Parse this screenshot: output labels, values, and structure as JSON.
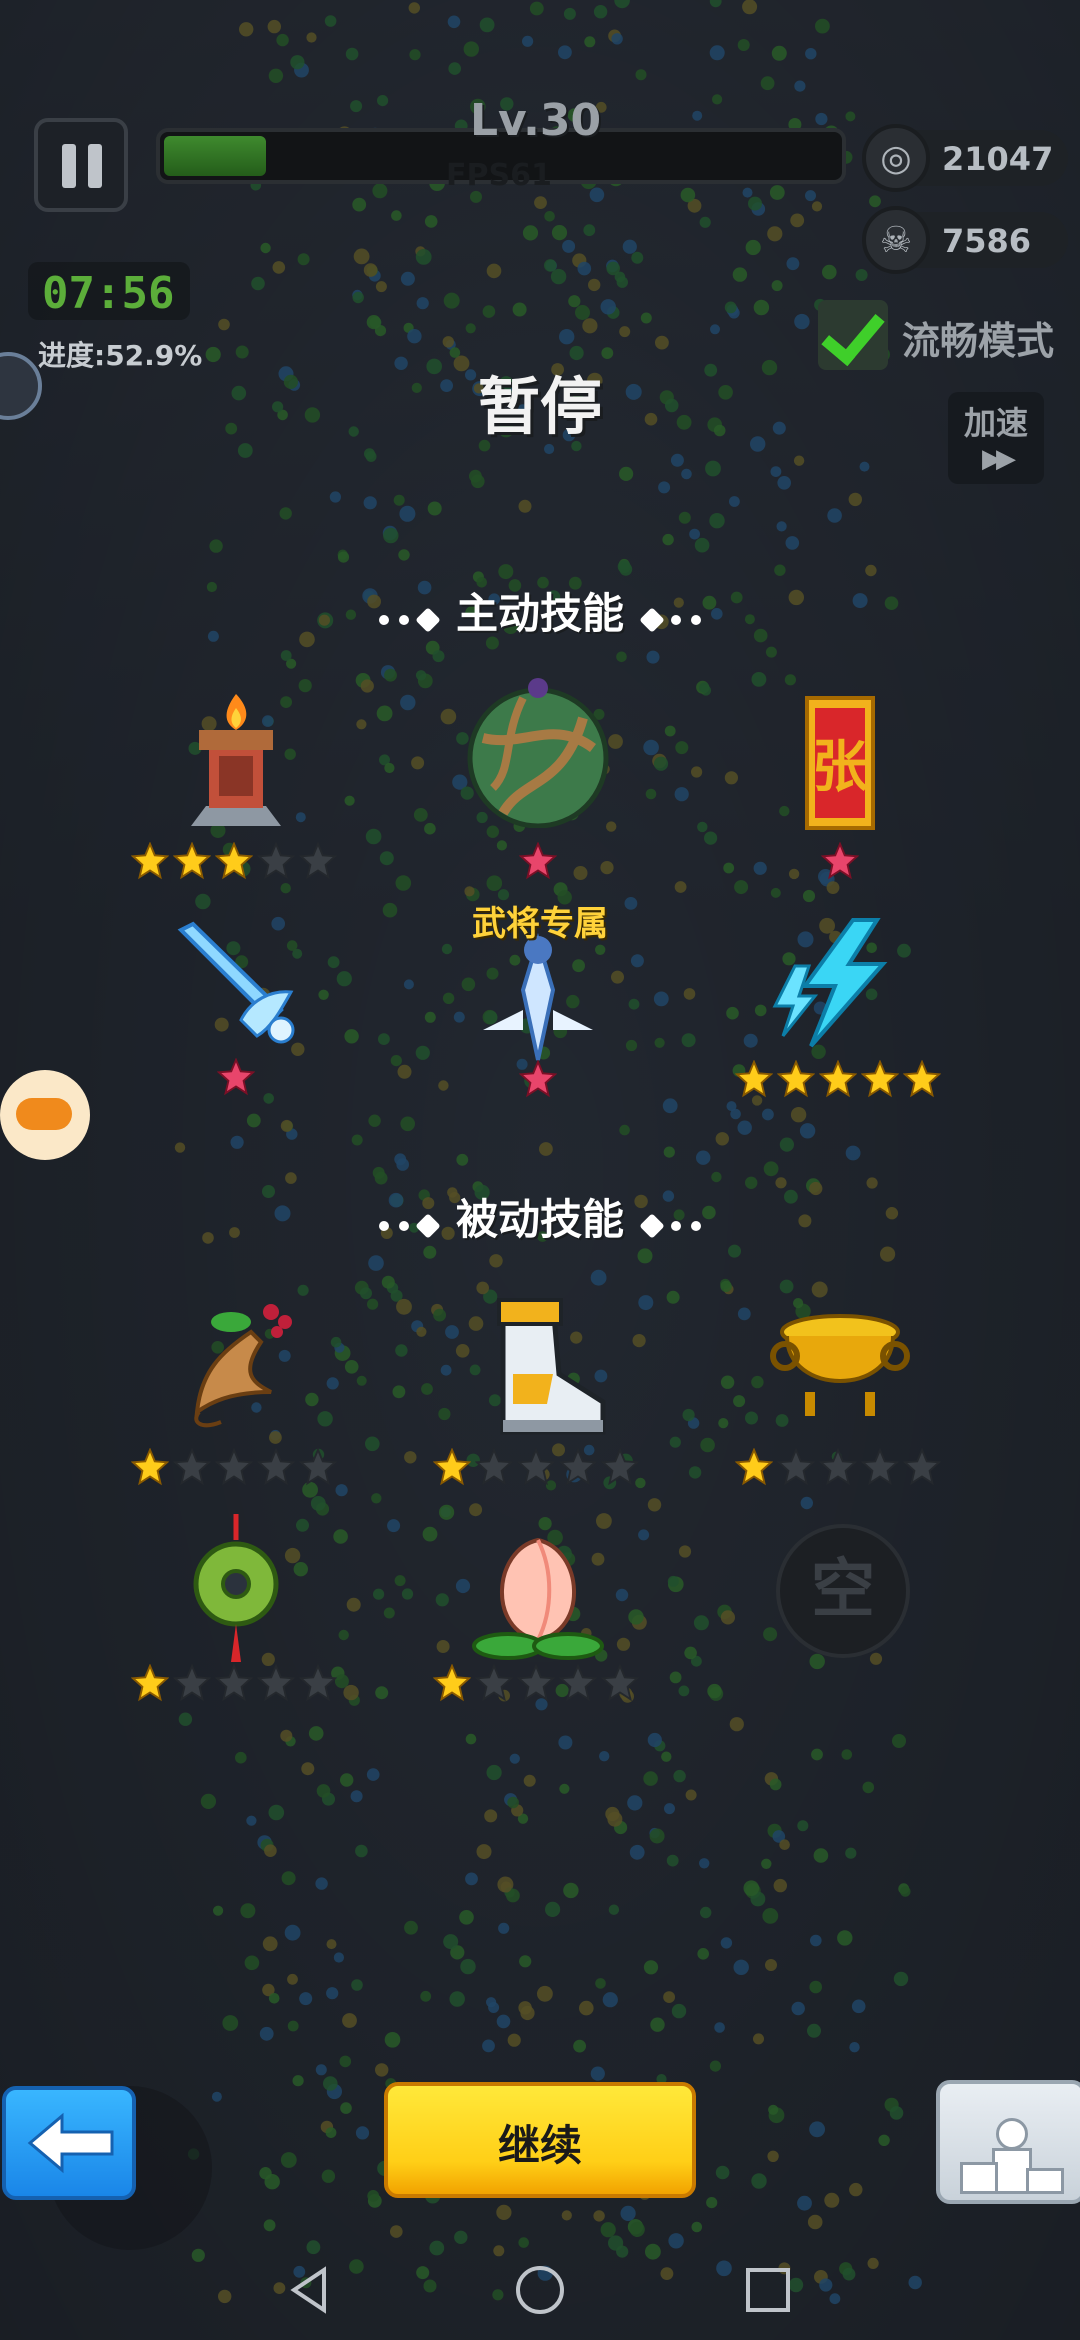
{
  "hud": {
    "level": "Lv.30",
    "fps": "FPS61",
    "level_progress": 0.15,
    "coins": "21047",
    "kills": "7586",
    "timer": "07:56",
    "progress": "进度:52.9%",
    "smooth_mode": "流畅模式",
    "speed_up": "加速"
  },
  "title": "暂停",
  "active_section": "主动技能",
  "passive_section": "被动技能",
  "exclusive_label": "武将专属",
  "active_skills": [
    {
      "name": "fire-tower",
      "stars": 3,
      "max": 5
    },
    {
      "name": "green-orb",
      "gem": true
    },
    {
      "name": "zhang-seal",
      "gem": true
    },
    {
      "name": "ice-sword",
      "gem": true
    },
    {
      "name": "thunder-blade",
      "gem": true
    },
    {
      "name": "lightning",
      "stars": 5,
      "max": 5
    }
  ],
  "passive_skills": [
    {
      "name": "ginseng",
      "stars": 1,
      "max": 5
    },
    {
      "name": "boots",
      "stars": 1,
      "max": 5
    },
    {
      "name": "golden-cauldron",
      "stars": 1,
      "max": 5
    },
    {
      "name": "jade-pendant",
      "stars": 1,
      "max": 5
    },
    {
      "name": "peach",
      "stars": 1,
      "max": 5
    }
  ],
  "empty_slot": "空",
  "buttons": {
    "continue": "继续"
  },
  "colors": {
    "accent_yellow": "#ffd23a",
    "star_on": "#ffcc1a",
    "star_off": "#3a3f45",
    "gem": "#e8456b",
    "progress_green": "#3f8a2e"
  }
}
